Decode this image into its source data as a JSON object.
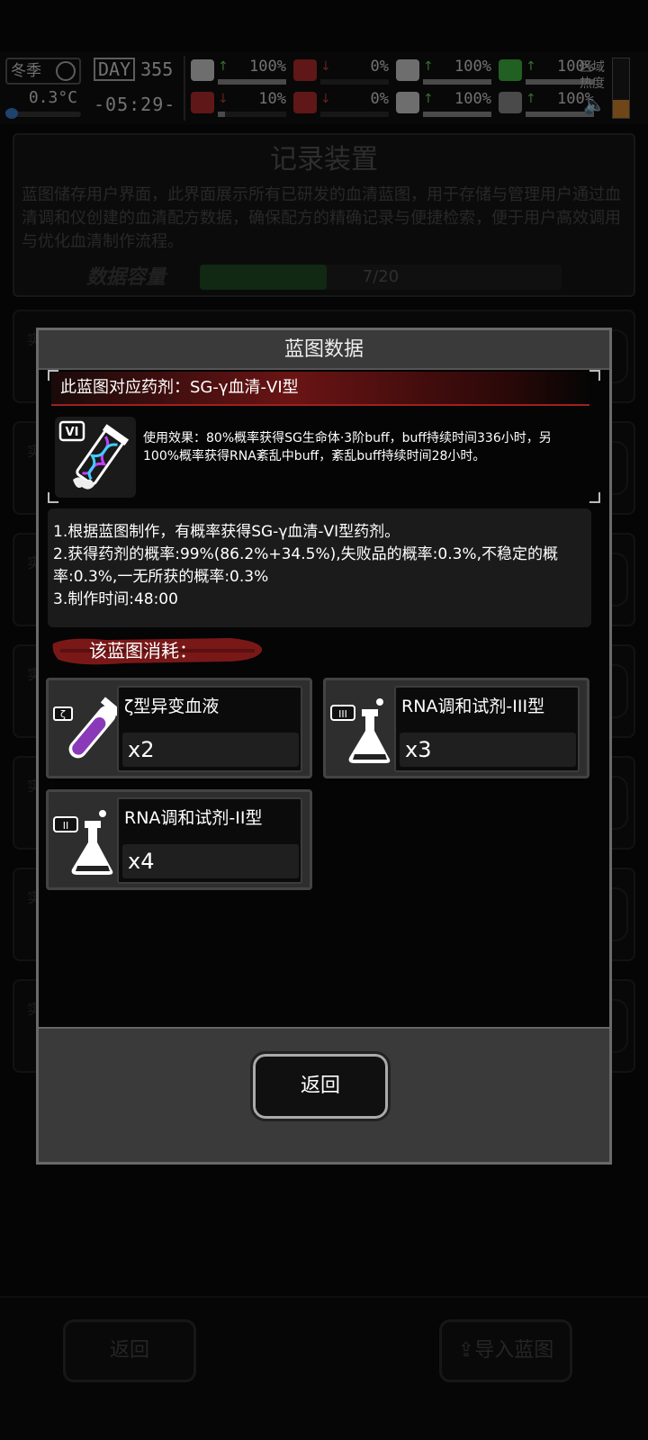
{
  "status": {
    "season": "冬季",
    "temperature": "0.3°C",
    "day_label": "DAY",
    "day_number": "355",
    "time": "-05:29-",
    "stats": [
      {
        "name": "medkit",
        "value": "100%",
        "arrow": "up",
        "color": "#5fcf5f",
        "fill": 1.0
      },
      {
        "name": "stomach",
        "value": "0%",
        "arrow": "down",
        "color": "#c23a3a",
        "fill": 0.0
      },
      {
        "name": "pill",
        "value": "100%",
        "arrow": "up",
        "color": "#5fcf5f",
        "fill": 1.0
      },
      {
        "name": "stamina",
        "value": "100%",
        "arrow": "up",
        "color": "#5fcf5f",
        "fill": 1.0
      },
      {
        "name": "brain",
        "value": "10%",
        "arrow": "down",
        "color": "#c23a3a",
        "fill": 0.1
      },
      {
        "name": "blood",
        "value": "0%",
        "arrow": "down",
        "color": "#c23a3a",
        "fill": 0.0
      },
      {
        "name": "heart",
        "value": "100%",
        "arrow": "up",
        "color": "#5fcf5f",
        "fill": 1.0
      },
      {
        "name": "mood",
        "value": "100%",
        "arrow": "up",
        "color": "#5fcf5f",
        "fill": 1.0
      }
    ],
    "region_label": "区域热度",
    "region_heat": 0.3
  },
  "background": {
    "title": "记录装置",
    "description": "蓝图储存用户界面，此界面展示所有已研发的血清蓝图，用于存储与管理用户通过血清调和仪创建的血清配方数据，确保配方的精确记录与便捷检索，便于用户高效调用与优化血清制作流程。",
    "capacity_label": "数据容量",
    "capacity_text": "7/20",
    "capacity_value": 7,
    "capacity_max": 20,
    "row_initial": "实",
    "back_label": "返回",
    "import_label": "导入蓝图"
  },
  "modal": {
    "title": "蓝图数据",
    "blueprint_name": "此蓝图对应药剂：SG-γ血清-VI型",
    "blueprint_icon_badge": "VI",
    "effect": "使用效果：80%概率获得SG生命体·3阶buff，buff持续时间336小时，另100%概率获得RNA紊乱中buff，紊乱buff持续时间28小时。",
    "info_lines": [
      "1.根据蓝图制作，有概率获得SG-γ血清-VI型药剂。",
      "2.获得药剂的概率:99%(86.2%+34.5%),失败品的概率:0.3%,不稳定的概率:0.3%,一无所获的概率:0.3%",
      "3.制作时间:48:00"
    ],
    "consume_label": "该蓝图消耗：",
    "materials": [
      {
        "name": "ζ型异变血液",
        "count": "x2",
        "badge": "ζ",
        "icon": "vial-icon"
      },
      {
        "name": "RNA调和试剂-III型",
        "count": "x3",
        "badge": "III",
        "icon": "flask-icon"
      },
      {
        "name": "RNA调和试剂-II型",
        "count": "x4",
        "badge": "II",
        "icon": "flask-icon"
      }
    ],
    "back_label": "返回"
  }
}
